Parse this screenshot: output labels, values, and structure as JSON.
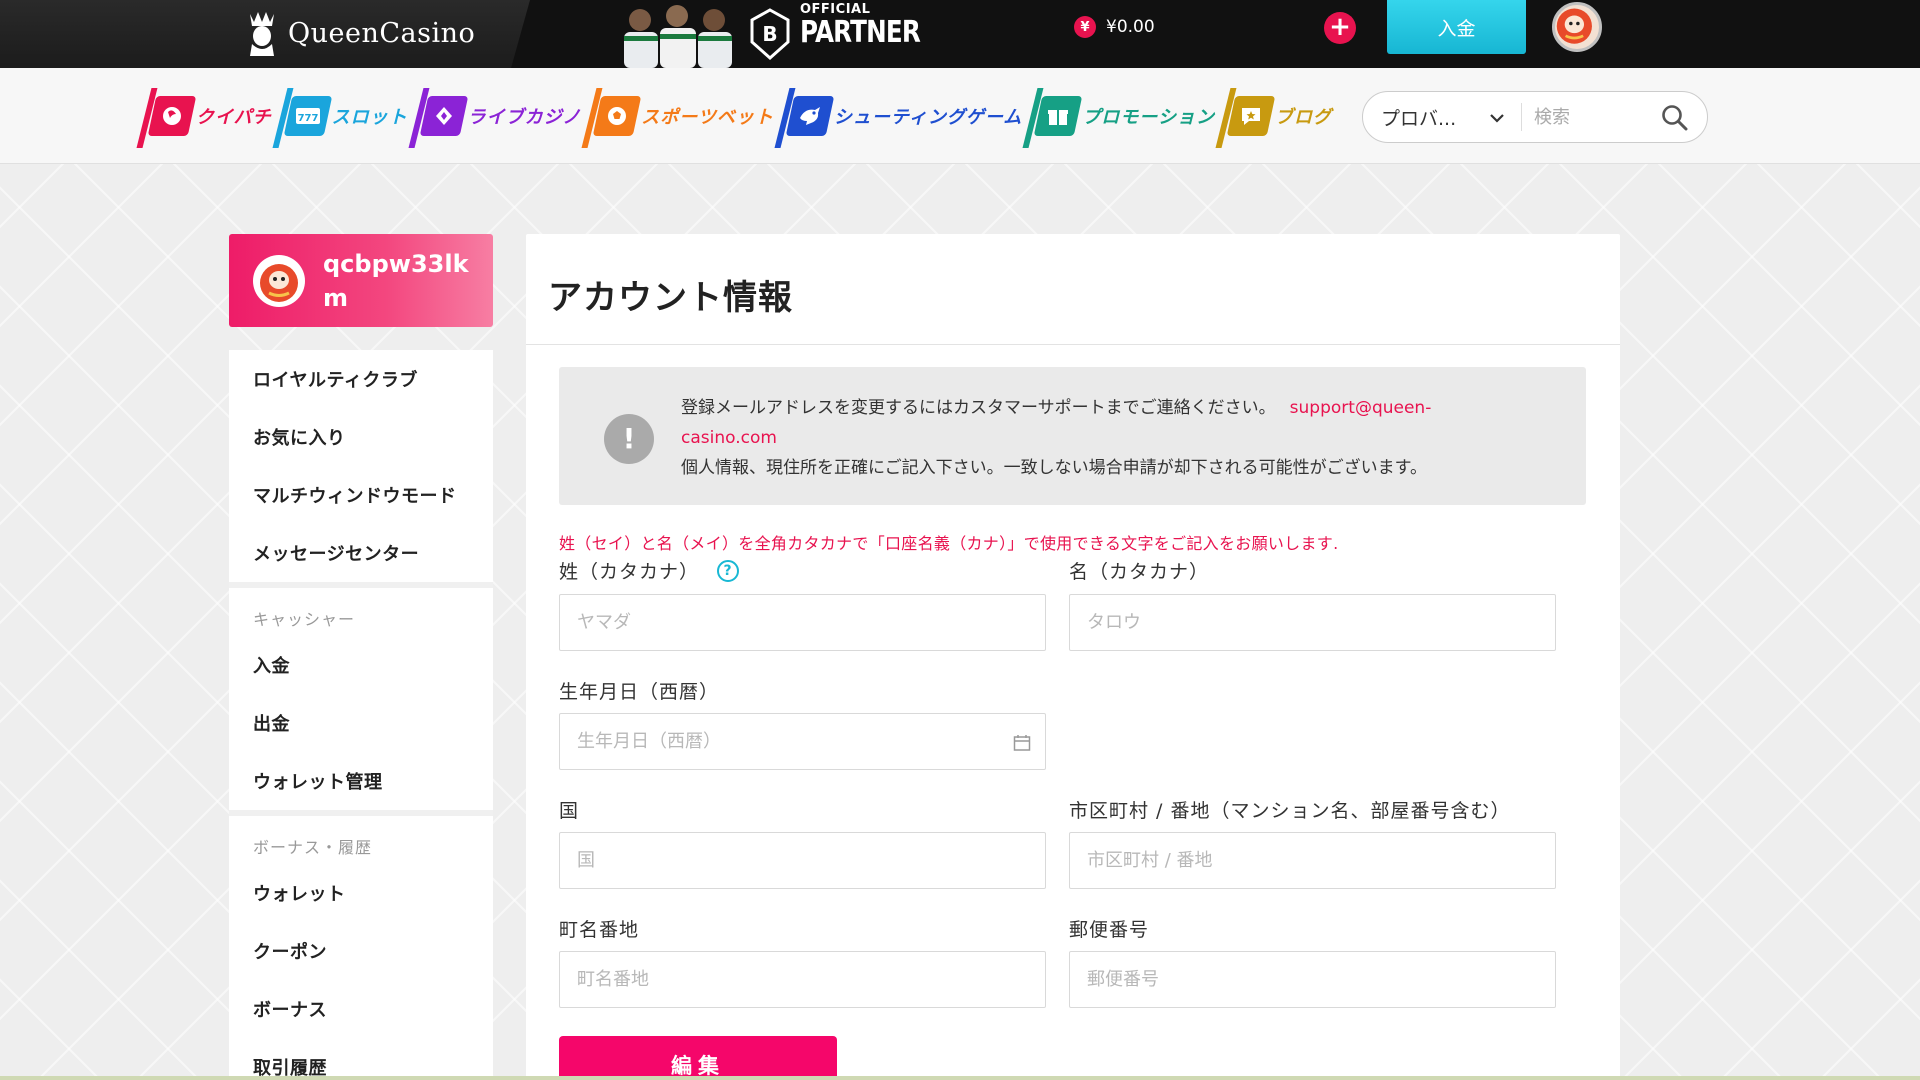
{
  "header": {
    "brand": "QueenCasino",
    "partner_small": "OFFICIAL",
    "partner_big": "PARTNER",
    "balance": "¥0.00",
    "currency_symbol": "¥",
    "plus_label": "+",
    "deposit_label": "入金"
  },
  "nav": {
    "items": [
      {
        "label": "クイパチ",
        "color": "#e8134f",
        "icon": "pachinko-icon"
      },
      {
        "label": "スロット",
        "color": "#1aa5dc",
        "icon": "slot-icon"
      },
      {
        "label": "ライブカジノ",
        "color": "#8b23d6",
        "icon": "live-casino-icon"
      },
      {
        "label": "スポーツベット",
        "color": "#f47a18",
        "icon": "sports-icon"
      },
      {
        "label": "シューティングゲーム",
        "color": "#1f4fd0",
        "icon": "shooting-icon"
      },
      {
        "label": "プロモーション",
        "color": "#16a085",
        "icon": "promotion-icon"
      },
      {
        "label": "ブログ",
        "color": "#c89a10",
        "icon": "blog-icon"
      }
    ],
    "provider_select": "プロバ...",
    "search_placeholder": "検索"
  },
  "sidebar": {
    "username": "qcbpw33lkm",
    "group1": [
      "ロイヤルティクラブ",
      "お気に入り",
      "マルチウィンドウモード",
      "メッセージセンター"
    ],
    "cashier_heading": "キャッシャー",
    "cashier": [
      "入金",
      "出金",
      "ウォレット管理"
    ],
    "history_heading": "ボーナス・履歴",
    "history": [
      "ウォレット",
      "クーポン",
      "ボーナス",
      "取引履歴"
    ]
  },
  "main": {
    "title": "アカウント情報",
    "notice_line1": "登録メールアドレスを変更するにはカスタマーサポートまでご連絡ください。",
    "notice_email": "support@queen-casino.com",
    "notice_line2": "個人情報、現住所を正確にご記入下さい。一致しない場合申請が却下される可能性がございます。",
    "warning": "姓（セイ）と名（メイ）を全角カタカナで「口座名義（カナ）」で使用できる文字をご記入をお願いします.",
    "help_icon_label": "?",
    "fields": {
      "last_name": {
        "label": "姓（カタカナ）",
        "placeholder": "ヤマダ"
      },
      "first_name": {
        "label": "名（カタカナ）",
        "placeholder": "タロウ"
      },
      "birthday": {
        "label": "生年月日（西暦）",
        "placeholder": "生年月日（西暦）"
      },
      "country": {
        "label": "国",
        "placeholder": "国"
      },
      "city": {
        "label": "市区町村 / 番地（マンション名、部屋番号含む）",
        "placeholder": "市区町村 / 番地"
      },
      "town": {
        "label": "町名番地",
        "placeholder": "町名番地"
      },
      "postal": {
        "label": "郵便番号",
        "placeholder": "郵便番号"
      }
    },
    "edit_button": "編集"
  },
  "colors": {
    "accent_pink": "#e8134f",
    "button_pink": "#f5066a",
    "deposit_cyan": "#1fc3dd"
  }
}
